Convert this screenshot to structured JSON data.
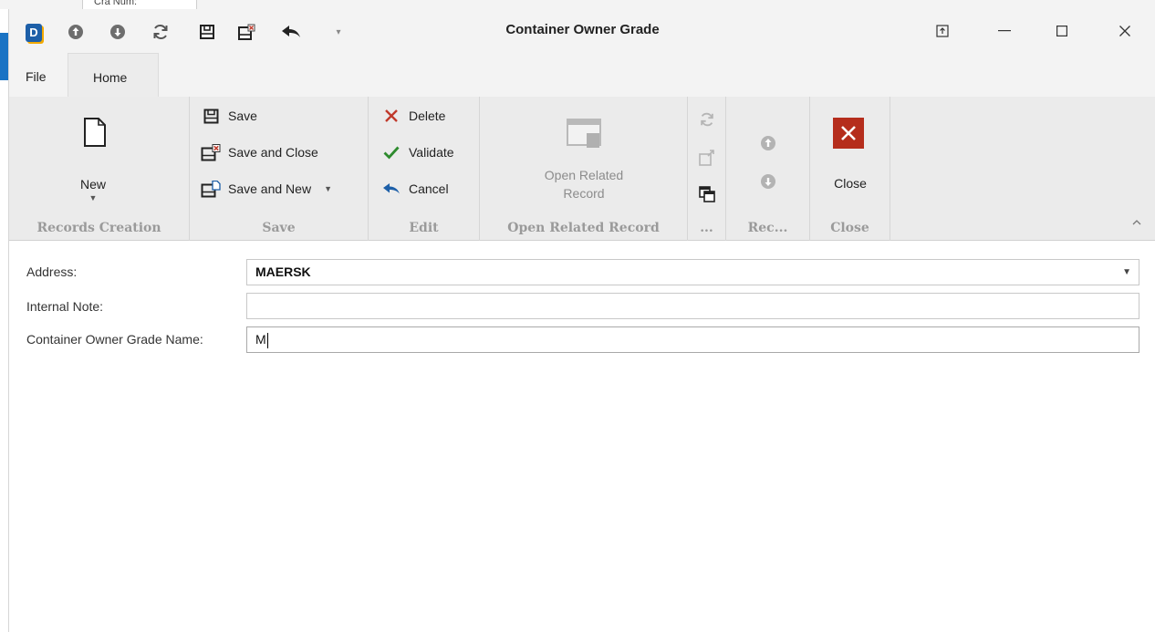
{
  "background": {
    "tab_fragment": "Cra Num:"
  },
  "window": {
    "title": "Container Owner Grade",
    "app_logo_letter": "D"
  },
  "quick_access": [
    {
      "icon": "arrow-up-circle-icon"
    },
    {
      "icon": "arrow-down-circle-icon"
    },
    {
      "icon": "refresh-icon"
    },
    {
      "icon": "save-icon"
    },
    {
      "icon": "save-close-icon"
    },
    {
      "icon": "undo-arrow-icon"
    },
    {
      "icon": "customize-dropdown-icon"
    }
  ],
  "tabs": {
    "file": "File",
    "home": "Home"
  },
  "ribbon": {
    "records_creation": {
      "label": "Records Creation",
      "new": "New"
    },
    "save": {
      "label": "Save",
      "save": "Save",
      "save_and_close": "Save and Close",
      "save_and_new": "Save and New"
    },
    "edit": {
      "label": "Edit",
      "delete": "Delete",
      "validate": "Validate",
      "cancel": "Cancel"
    },
    "open_related_record": {
      "label": "Open Related Record",
      "button_line1": "Open Related",
      "button_line2": "Record"
    },
    "misc": {
      "label": "..."
    },
    "rec": {
      "label": "Rec..."
    },
    "close": {
      "label": "Close",
      "button": "Close"
    }
  },
  "form": {
    "address": {
      "label": "Address:",
      "value": "MAERSK"
    },
    "internal_note": {
      "label": "Internal Note:",
      "value": ""
    },
    "grade_name": {
      "label": "Container Owner Grade Name:",
      "value": "M"
    }
  },
  "colors": {
    "accent_blue": "#1a73c4",
    "close_red": "#b52d1c",
    "validate_green": "#2e8b2e",
    "delete_red": "#c0392b",
    "cancel_blue": "#1d5fa8"
  }
}
